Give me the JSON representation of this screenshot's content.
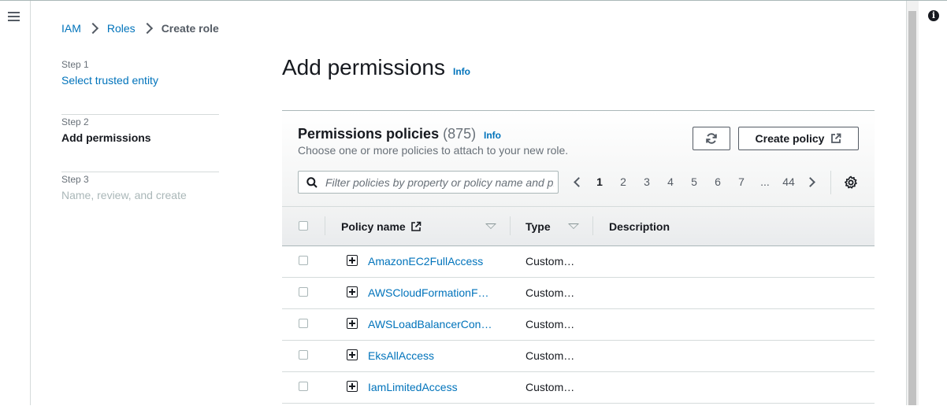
{
  "breadcrumb": {
    "items": [
      "IAM",
      "Roles"
    ],
    "current": "Create role"
  },
  "steps": [
    {
      "label": "Step 1",
      "title": "Select trusted entity"
    },
    {
      "label": "Step 2",
      "title": "Add permissions"
    },
    {
      "label": "Step 3",
      "title": "Name, review, and create"
    }
  ],
  "page": {
    "title": "Add permissions",
    "info": "Info"
  },
  "panel": {
    "title": "Permissions policies",
    "count": "(875)",
    "info": "Info",
    "description": "Choose one or more policies to attach to your new role.",
    "create_policy_label": "Create policy",
    "filter_placeholder": "Filter policies by property or policy name and press enter",
    "pagination": {
      "pages": [
        "1",
        "2",
        "3",
        "4",
        "5",
        "6",
        "7"
      ],
      "ellipsis": "...",
      "last": "44",
      "current": "1"
    }
  },
  "table": {
    "columns": {
      "name": "Policy name",
      "type": "Type",
      "description": "Description"
    },
    "rows": [
      {
        "name": "AmazonEC2FullAccess",
        "type": "Custom…"
      },
      {
        "name": "AWSCloudFormationF…",
        "type": "Custom…"
      },
      {
        "name": "AWSLoadBalancerCon…",
        "type": "Custom…"
      },
      {
        "name": "EksAllAccess",
        "type": "Custom…"
      },
      {
        "name": "IamLimitedAccess",
        "type": "Custom…"
      }
    ]
  },
  "colors": {
    "link": "#0073bb",
    "text": "#16191f",
    "muted": "#687078"
  }
}
